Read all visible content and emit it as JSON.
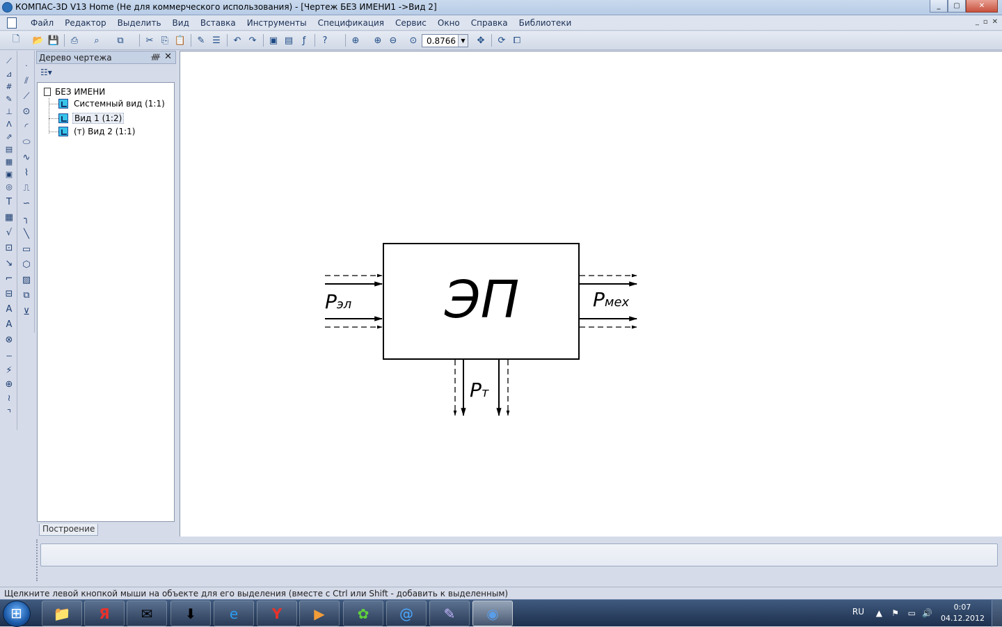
{
  "window": {
    "title": "КОМПАС-3D V13 Home (Не для коммерческого использования) - [Чертеж БЕЗ ИМЕНИ1 ->Вид 2]",
    "buttons": [
      "_",
      "▢",
      "✕"
    ]
  },
  "menu": {
    "items": [
      "Файл",
      "Редактор",
      "Выделить",
      "Вид",
      "Вставка",
      "Инструменты",
      "Спецификация",
      "Сервис",
      "Окно",
      "Справка",
      "Библиотеки"
    ],
    "mdi_controls": [
      "_",
      "▫",
      "✕"
    ]
  },
  "toolbar": {
    "zoom_value": "0.8766",
    "icons": [
      "new-document-icon",
      "open-icon",
      "save-icon",
      "print-icon",
      "print-preview-icon",
      "copy-properties-icon",
      "cut-icon",
      "copy-icon",
      "paste-icon",
      "format-brush-icon",
      "properties-list-icon",
      "undo-icon",
      "redo-icon",
      "manager-icon",
      "libraries-icon",
      "variables-icon",
      "help-cursor-icon",
      "zoom-window-icon",
      "zoom-in-icon",
      "zoom-out-icon",
      "zoom-scale-icon",
      "pan-icon",
      "refresh-icon",
      "show-all-icon"
    ]
  },
  "tree": {
    "title": "Дерево чертежа",
    "pin": "ᚎ",
    "close": "✕",
    "root": "БЕЗ ИМЕНИ",
    "items": [
      {
        "label": "Системный вид (1:1)",
        "selected": false
      },
      {
        "label": "Вид 1 (1:2)",
        "selected": true
      },
      {
        "label": "(т) Вид 2 (1:1)",
        "selected": false
      }
    ],
    "tab": "Построение"
  },
  "drawing": {
    "block_label": "ЭП",
    "left_label_main": "P",
    "left_label_sub": "эл",
    "right_label_main": "P",
    "right_label_sub": "мех",
    "bottom_label_main": "P",
    "bottom_label_sub": "т"
  },
  "status": {
    "text": "Щелкните левой кнопкой мыши на объекте для его выделения (вместе с Ctrl или Shift - добавить к выделенным)"
  },
  "taskbar": {
    "apps": [
      "explorer-icon",
      "yandex-icon",
      "mail-icon",
      "download-icon",
      "ie-icon",
      "yandex-browser-icon",
      "media-icon",
      "icq-icon",
      "mail-agent-icon",
      "kompas-file-icon",
      "kompas-icon"
    ],
    "lang": "RU",
    "time": "0:07",
    "date": "04.12.2012"
  }
}
